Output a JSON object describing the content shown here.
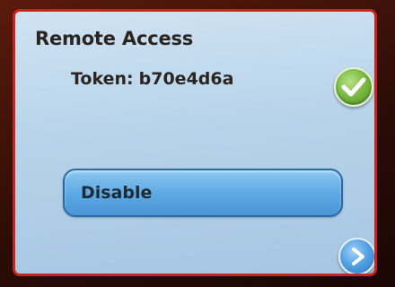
{
  "screen": {
    "title": "Remote Access",
    "token_label": "Token:",
    "token_value": "b70e4d6a"
  },
  "actions": {
    "confirm_icon": "checkmark-icon",
    "disable_label": "Disable",
    "next_icon": "chevron-right-icon"
  },
  "colors": {
    "screen_border": "#c9231b",
    "confirm_green": "#7cbc44",
    "button_blue": "#5aa8e4"
  }
}
